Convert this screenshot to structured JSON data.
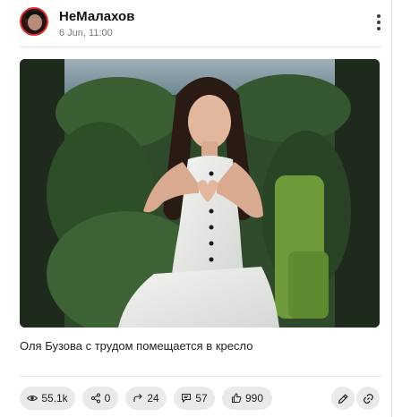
{
  "post": {
    "channel_name": "НеМалахов",
    "date": "6 Jun, 11:00",
    "caption": "Оля Бузова с трудом помещается в кресло"
  },
  "stats": {
    "views": "55.1k",
    "shares": "0",
    "forwards": "24",
    "comments": "57",
    "reactions": "990"
  },
  "icons": {
    "avatar": "channel-avatar",
    "more": "more-vertical-icon",
    "views": "eye-icon",
    "shares": "share-icon",
    "forwards": "forward-arrow-icon",
    "comments": "comments-icon",
    "reactions": "thumbs-up-icon",
    "edit": "pencil-icon",
    "link": "link-icon"
  },
  "colors": {
    "pill_background": "#e9eaec",
    "text_primary": "#111111",
    "text_secondary": "#7a7a7a",
    "avatar_border": "#d23232"
  }
}
